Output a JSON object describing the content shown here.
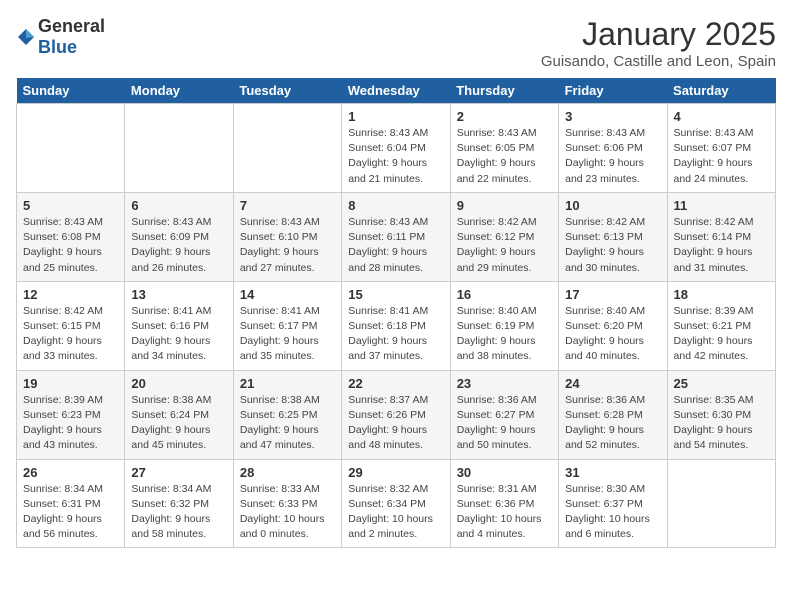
{
  "header": {
    "logo_general": "General",
    "logo_blue": "Blue",
    "month": "January 2025",
    "location": "Guisando, Castille and Leon, Spain"
  },
  "days_of_week": [
    "Sunday",
    "Monday",
    "Tuesday",
    "Wednesday",
    "Thursday",
    "Friday",
    "Saturday"
  ],
  "weeks": [
    [
      {
        "day": "",
        "info": ""
      },
      {
        "day": "",
        "info": ""
      },
      {
        "day": "",
        "info": ""
      },
      {
        "day": "1",
        "info": "Sunrise: 8:43 AM\nSunset: 6:04 PM\nDaylight: 9 hours\nand 21 minutes."
      },
      {
        "day": "2",
        "info": "Sunrise: 8:43 AM\nSunset: 6:05 PM\nDaylight: 9 hours\nand 22 minutes."
      },
      {
        "day": "3",
        "info": "Sunrise: 8:43 AM\nSunset: 6:06 PM\nDaylight: 9 hours\nand 23 minutes."
      },
      {
        "day": "4",
        "info": "Sunrise: 8:43 AM\nSunset: 6:07 PM\nDaylight: 9 hours\nand 24 minutes."
      }
    ],
    [
      {
        "day": "5",
        "info": "Sunrise: 8:43 AM\nSunset: 6:08 PM\nDaylight: 9 hours\nand 25 minutes."
      },
      {
        "day": "6",
        "info": "Sunrise: 8:43 AM\nSunset: 6:09 PM\nDaylight: 9 hours\nand 26 minutes."
      },
      {
        "day": "7",
        "info": "Sunrise: 8:43 AM\nSunset: 6:10 PM\nDaylight: 9 hours\nand 27 minutes."
      },
      {
        "day": "8",
        "info": "Sunrise: 8:43 AM\nSunset: 6:11 PM\nDaylight: 9 hours\nand 28 minutes."
      },
      {
        "day": "9",
        "info": "Sunrise: 8:42 AM\nSunset: 6:12 PM\nDaylight: 9 hours\nand 29 minutes."
      },
      {
        "day": "10",
        "info": "Sunrise: 8:42 AM\nSunset: 6:13 PM\nDaylight: 9 hours\nand 30 minutes."
      },
      {
        "day": "11",
        "info": "Sunrise: 8:42 AM\nSunset: 6:14 PM\nDaylight: 9 hours\nand 31 minutes."
      }
    ],
    [
      {
        "day": "12",
        "info": "Sunrise: 8:42 AM\nSunset: 6:15 PM\nDaylight: 9 hours\nand 33 minutes."
      },
      {
        "day": "13",
        "info": "Sunrise: 8:41 AM\nSunset: 6:16 PM\nDaylight: 9 hours\nand 34 minutes."
      },
      {
        "day": "14",
        "info": "Sunrise: 8:41 AM\nSunset: 6:17 PM\nDaylight: 9 hours\nand 35 minutes."
      },
      {
        "day": "15",
        "info": "Sunrise: 8:41 AM\nSunset: 6:18 PM\nDaylight: 9 hours\nand 37 minutes."
      },
      {
        "day": "16",
        "info": "Sunrise: 8:40 AM\nSunset: 6:19 PM\nDaylight: 9 hours\nand 38 minutes."
      },
      {
        "day": "17",
        "info": "Sunrise: 8:40 AM\nSunset: 6:20 PM\nDaylight: 9 hours\nand 40 minutes."
      },
      {
        "day": "18",
        "info": "Sunrise: 8:39 AM\nSunset: 6:21 PM\nDaylight: 9 hours\nand 42 minutes."
      }
    ],
    [
      {
        "day": "19",
        "info": "Sunrise: 8:39 AM\nSunset: 6:23 PM\nDaylight: 9 hours\nand 43 minutes."
      },
      {
        "day": "20",
        "info": "Sunrise: 8:38 AM\nSunset: 6:24 PM\nDaylight: 9 hours\nand 45 minutes."
      },
      {
        "day": "21",
        "info": "Sunrise: 8:38 AM\nSunset: 6:25 PM\nDaylight: 9 hours\nand 47 minutes."
      },
      {
        "day": "22",
        "info": "Sunrise: 8:37 AM\nSunset: 6:26 PM\nDaylight: 9 hours\nand 48 minutes."
      },
      {
        "day": "23",
        "info": "Sunrise: 8:36 AM\nSunset: 6:27 PM\nDaylight: 9 hours\nand 50 minutes."
      },
      {
        "day": "24",
        "info": "Sunrise: 8:36 AM\nSunset: 6:28 PM\nDaylight: 9 hours\nand 52 minutes."
      },
      {
        "day": "25",
        "info": "Sunrise: 8:35 AM\nSunset: 6:30 PM\nDaylight: 9 hours\nand 54 minutes."
      }
    ],
    [
      {
        "day": "26",
        "info": "Sunrise: 8:34 AM\nSunset: 6:31 PM\nDaylight: 9 hours\nand 56 minutes."
      },
      {
        "day": "27",
        "info": "Sunrise: 8:34 AM\nSunset: 6:32 PM\nDaylight: 9 hours\nand 58 minutes."
      },
      {
        "day": "28",
        "info": "Sunrise: 8:33 AM\nSunset: 6:33 PM\nDaylight: 10 hours\nand 0 minutes."
      },
      {
        "day": "29",
        "info": "Sunrise: 8:32 AM\nSunset: 6:34 PM\nDaylight: 10 hours\nand 2 minutes."
      },
      {
        "day": "30",
        "info": "Sunrise: 8:31 AM\nSunset: 6:36 PM\nDaylight: 10 hours\nand 4 minutes."
      },
      {
        "day": "31",
        "info": "Sunrise: 8:30 AM\nSunset: 6:37 PM\nDaylight: 10 hours\nand 6 minutes."
      },
      {
        "day": "",
        "info": ""
      }
    ]
  ]
}
